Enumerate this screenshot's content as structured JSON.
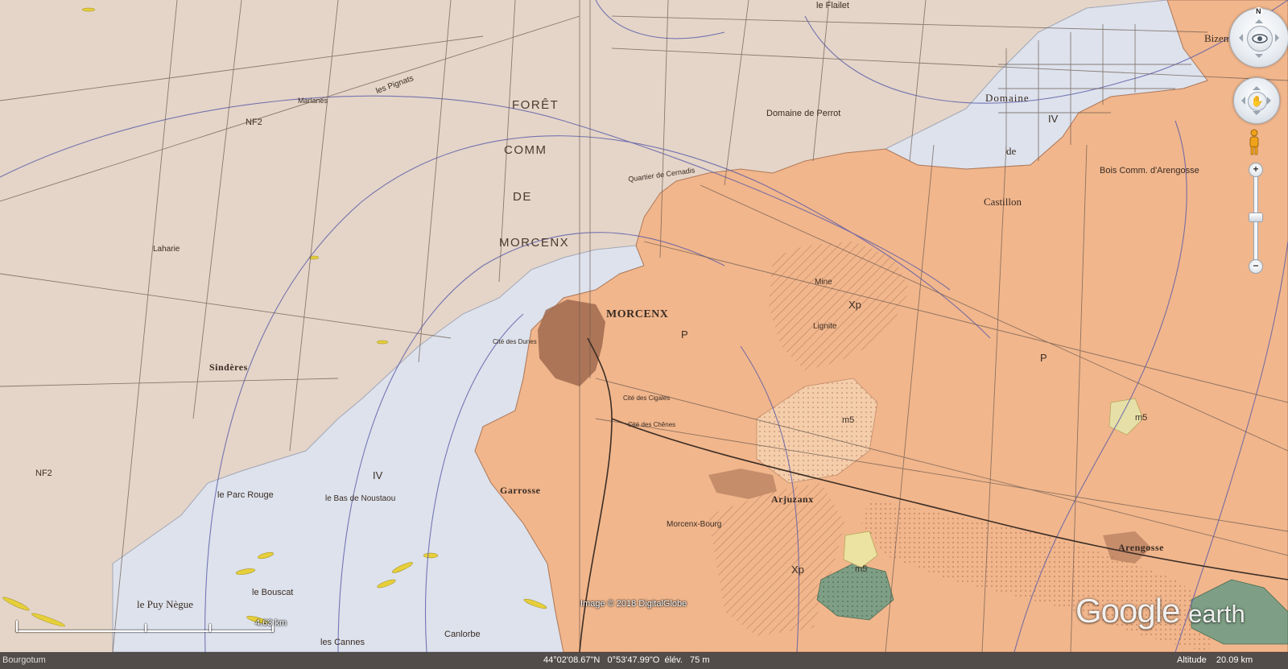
{
  "map": {
    "colors": {
      "base": "#e4d5c8",
      "sand_plateau": "#f1b68c",
      "alluvium": "#dde2ec",
      "lignite_field": "#f6c9a0",
      "clay_green": "#7e9f85",
      "yellow_lens": "#e7cf3a",
      "roads": "#6d5a50",
      "contours": "#5a5aa8"
    },
    "towns": [
      "MORCENX",
      "Arjuzanx",
      "Arengosse",
      "Garrosse",
      "Sindères",
      "Laharie"
    ],
    "forest_labels": [
      "FORÊT",
      "COMM",
      "DE",
      "MORCENX"
    ],
    "places": [
      "Domaine",
      "de",
      "Castillon",
      "Domaine de Perrot",
      "Bois Comm. d'Arengosse",
      "le Parc Rouge",
      "le Puy Nègue",
      "le Bouscat",
      "les Cannes",
      "Canlorbe",
      "le Bas de Noustaou",
      "Cité des Dunes",
      "Cité des Cigales",
      "Cité des Chênes",
      "Morcenx-Bourg",
      "Marlanes",
      "les Pignats",
      "le Flailet",
      "Bizen",
      "Mine",
      "Lignite",
      "Quartier de Cernadis"
    ],
    "units": [
      "NF2",
      "NF2",
      "IV",
      "IV",
      "P",
      "P",
      "Xp",
      "Xp",
      "m5",
      "m5",
      "m5"
    ]
  },
  "navigation": {
    "compass_north": "N",
    "zoom_in": "+",
    "zoom_out": "−"
  },
  "overlay": {
    "imagery_credit": "Image © 2018 DigitalGlobe",
    "logo_google": "Google",
    "logo_earth": "earth",
    "scale_label": "4.63  km"
  },
  "status_bar": {
    "left_text": "Bourgotum",
    "coords": "44°02'08.67\"N   0°53'47.99\"O  élév.   75 m",
    "altitude": "Altitude    20.09 km"
  }
}
